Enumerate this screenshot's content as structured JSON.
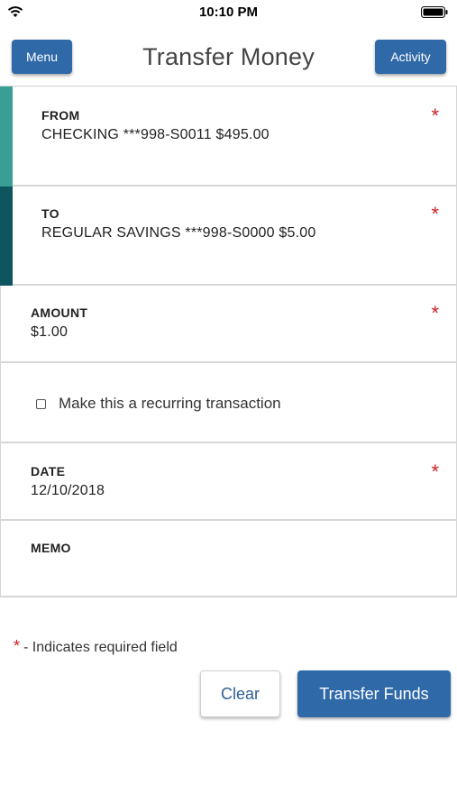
{
  "status_bar": {
    "time": "10:10 PM"
  },
  "header": {
    "menu_label": "Menu",
    "title": "Transfer Money",
    "activity_label": "Activity"
  },
  "form": {
    "from": {
      "label": "FROM",
      "value": "CHECKING ***998-S0011 $495.00"
    },
    "to": {
      "label": "TO",
      "value": "REGULAR SAVINGS ***998-S0000 $5.00"
    },
    "amount": {
      "label": "AMOUNT",
      "value": "$1.00"
    },
    "recurring": {
      "label": "Make this a recurring transaction",
      "checked": false
    },
    "date": {
      "label": "DATE",
      "value": "12/10/2018"
    },
    "memo": {
      "label": "MEMO",
      "value": ""
    },
    "required_marker": "*"
  },
  "footer": {
    "required_note_marker": "*",
    "required_note_text": "- Indicates required field",
    "clear_label": "Clear",
    "transfer_label": "Transfer Funds"
  },
  "colors": {
    "primary": "#2f69a8",
    "accent_from": "#3a9e95",
    "accent_to": "#0f5560",
    "required": "#cc1f1f"
  }
}
